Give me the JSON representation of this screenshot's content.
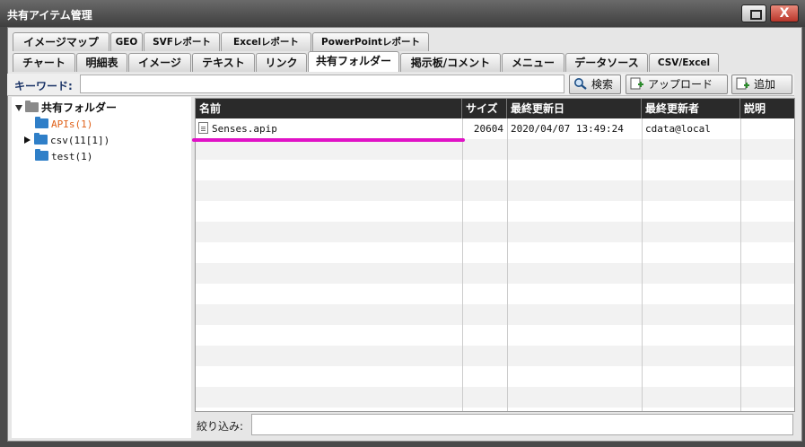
{
  "window": {
    "title": "共有アイテム管理",
    "close_label": "X"
  },
  "tabs_row1": [
    "イメージマップ",
    "GEO",
    "SVFレポート",
    "Excelレポート",
    "PowerPointレポート"
  ],
  "tabs_row2": [
    "チャート",
    "明細表",
    "イメージ",
    "テキスト",
    "リンク",
    "共有フォルダー",
    "掲示板/コメント",
    "メニュー",
    "データソース",
    "CSV/Excel"
  ],
  "active_tab": "共有フォルダー",
  "search": {
    "label": "キーワード:",
    "value": ""
  },
  "buttons": {
    "search": "検索",
    "upload": "アップロード",
    "add": "追加"
  },
  "tree": {
    "root": "共有フォルダー",
    "items": [
      {
        "label": "APIs(1)",
        "selected": true
      },
      {
        "label": "csv(11[1])",
        "expandable": true
      },
      {
        "label": "test(1)"
      }
    ]
  },
  "table": {
    "headers": [
      "名前",
      "サイズ",
      "最終更新日",
      "最終更新者",
      "説明"
    ],
    "rows": [
      {
        "name": "Senses.apip",
        "size": "20604",
        "modified": "2020/04/07 13:49:24",
        "modified_by": "cdata@local",
        "description": ""
      }
    ]
  },
  "filter": {
    "label": "絞り込み:",
    "value": ""
  },
  "colors": {
    "selected_text": "#e0621a",
    "highlight": "#e012c6",
    "header_bg": "#2a2a2a",
    "folder": "#2f7fc8"
  }
}
